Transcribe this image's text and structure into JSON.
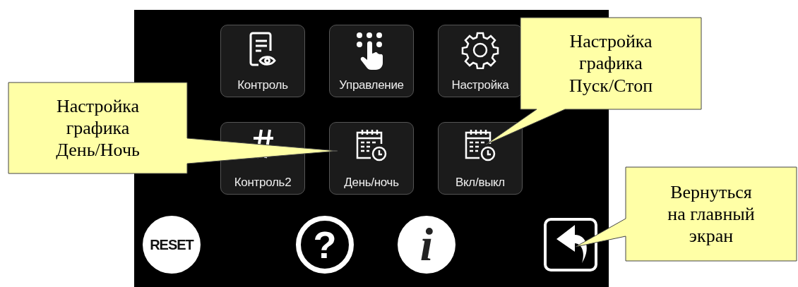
{
  "tiles": [
    {
      "label": "Контроль",
      "kind": "document"
    },
    {
      "label": "Управление",
      "kind": "hand"
    },
    {
      "label": "Настройка",
      "kind": "gear"
    },
    {
      "label": "Контроль2",
      "kind": "hash"
    },
    {
      "label": "День/ночь",
      "kind": "calendar"
    },
    {
      "label": "Вкл/выкл",
      "kind": "calendar"
    }
  ],
  "bottom_buttons": [
    {
      "kind": "reset",
      "label": "RESET"
    },
    {
      "kind": "help",
      "glyph": "?"
    },
    {
      "kind": "info",
      "glyph": "i"
    },
    {
      "kind": "back"
    }
  ],
  "callouts": [
    {
      "lines": [
        "Настройка",
        "графика",
        "День/Ночь"
      ],
      "kind": "left"
    },
    {
      "lines": [
        "Настройка",
        "графика",
        "Пуск/Стоп"
      ],
      "kind": "top"
    },
    {
      "lines": [
        "Вернуться",
        "на главный",
        "экран"
      ],
      "kind": "right"
    }
  ]
}
